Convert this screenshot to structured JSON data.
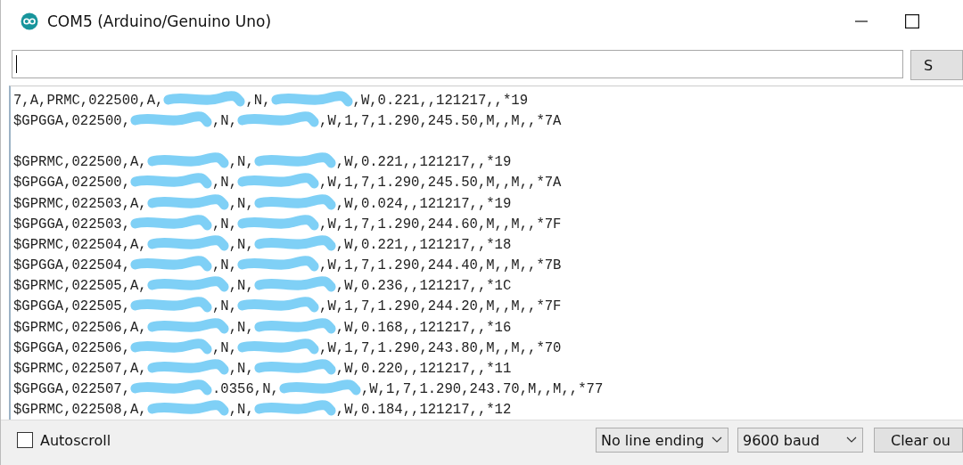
{
  "window": {
    "title": "COM5 (Arduino/Genuino Uno)"
  },
  "send_button": {
    "label": "S"
  },
  "output": {
    "lines": [
      {
        "kind": "text",
        "parts": [
          "7,A,PRMC,022500,A,",
          ",N,",
          ",W,0.221,,121217,,*19"
        ]
      },
      {
        "kind": "text",
        "parts": [
          "$GPGGA,022500,",
          ",N,",
          ",W,1,7,1.290,245.50,M,,M,,*7A"
        ]
      },
      {
        "kind": "blank"
      },
      {
        "kind": "text",
        "parts": [
          "$GPRMC,022500,A,",
          ",N,",
          ",W,0.221,,121217,,*19"
        ]
      },
      {
        "kind": "text",
        "parts": [
          "$GPGGA,022500,",
          ",N,",
          ",W,1,7,1.290,245.50,M,,M,,*7A"
        ]
      },
      {
        "kind": "text",
        "parts": [
          "$GPRMC,022503,A,",
          ",N,",
          ",W,0.024,,121217,,*19"
        ]
      },
      {
        "kind": "text",
        "parts": [
          "$GPGGA,022503,",
          ",N,",
          ",W,1,7,1.290,244.60,M,,M,,*7F"
        ]
      },
      {
        "kind": "text",
        "parts": [
          "$GPRMC,022504,A,",
          ",N,",
          ",W,0.221,,121217,,*18"
        ]
      },
      {
        "kind": "text",
        "parts": [
          "$GPGGA,022504,",
          ",N,",
          ",W,1,7,1.290,244.40,M,,M,,*7B"
        ]
      },
      {
        "kind": "text",
        "parts": [
          "$GPRMC,022505,A,",
          ",N,",
          ",W,0.236,,121217,,*1C"
        ]
      },
      {
        "kind": "text",
        "parts": [
          "$GPGGA,022505,",
          ",N,",
          ",W,1,7,1.290,244.20,M,,M,,*7F"
        ]
      },
      {
        "kind": "text",
        "parts": [
          "$GPRMC,022506,A,",
          ",N,",
          ",W,0.168,,121217,,*16"
        ]
      },
      {
        "kind": "text",
        "parts": [
          "$GPGGA,022506,",
          ",N,",
          ",W,1,7,1.290,243.80,M,,M,,*70"
        ]
      },
      {
        "kind": "text",
        "parts": [
          "$GPRMC,022507,A,",
          ",N,",
          ",W,0.220,,121217,,*11"
        ]
      },
      {
        "kind": "text",
        "parts": [
          "$GPGGA,022507,",
          ".0356,N,",
          ",W,1,7,1.290,243.70,M,,M,,*77"
        ]
      },
      {
        "kind": "text",
        "parts": [
          "$GPRMC,022508,A,",
          ",N,",
          ",W,0.184,,121217,,*12"
        ]
      }
    ]
  },
  "autoscroll": {
    "label": "Autoscroll",
    "checked": false
  },
  "line_ending": {
    "value": "No line ending"
  },
  "baud": {
    "value": "9600 baud"
  },
  "clear_button": {
    "label": "Clear ou"
  }
}
